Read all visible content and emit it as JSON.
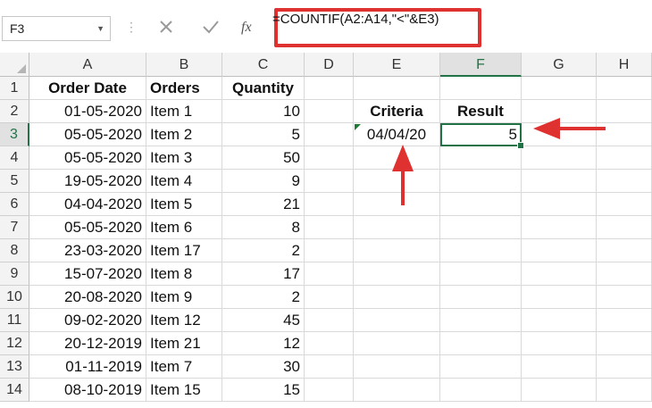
{
  "name_box": "F3",
  "formula": "=COUNTIF(A2:A14,\"<\"&E3)",
  "icons": {
    "cancel": "cross-icon",
    "enter": "check-icon",
    "function": "fx-icon"
  },
  "columns": [
    "A",
    "B",
    "C",
    "D",
    "E",
    "F",
    "G",
    "H"
  ],
  "rows": [
    "1",
    "2",
    "3",
    "4",
    "5",
    "6",
    "7",
    "8",
    "9",
    "10",
    "11",
    "12",
    "13",
    "14"
  ],
  "headers": {
    "date": "Order Date",
    "orders": "Orders",
    "quantity": "Quantity"
  },
  "records": [
    {
      "date": "01-05-2020",
      "item": "Item 1",
      "qty": "10"
    },
    {
      "date": "05-05-2020",
      "item": "Item 2",
      "qty": "5"
    },
    {
      "date": "05-05-2020",
      "item": "Item 3",
      "qty": "50"
    },
    {
      "date": "19-05-2020",
      "item": "Item 4",
      "qty": "9"
    },
    {
      "date": "04-04-2020",
      "item": "Item 5",
      "qty": "21"
    },
    {
      "date": "05-05-2020",
      "item": "Item 6",
      "qty": "8"
    },
    {
      "date": "23-03-2020",
      "item": "Item 17",
      "qty": "2"
    },
    {
      "date": "15-07-2020",
      "item": "Item 8",
      "qty": "17"
    },
    {
      "date": "20-08-2020",
      "item": "Item 9",
      "qty": "2"
    },
    {
      "date": "09-02-2020",
      "item": "Item 12",
      "qty": "45"
    },
    {
      "date": "20-12-2019",
      "item": "Item 21",
      "qty": "12"
    },
    {
      "date": "01-11-2019",
      "item": "Item 7",
      "qty": "30"
    },
    {
      "date": "08-10-2019",
      "item": "Item 15",
      "qty": "15"
    }
  ],
  "criteria_label": "Criteria",
  "result_label": "Result",
  "criteria_value": "04/04/20",
  "result_value": "5",
  "colors": {
    "accent": "#217346",
    "annotation": "#e03131"
  }
}
